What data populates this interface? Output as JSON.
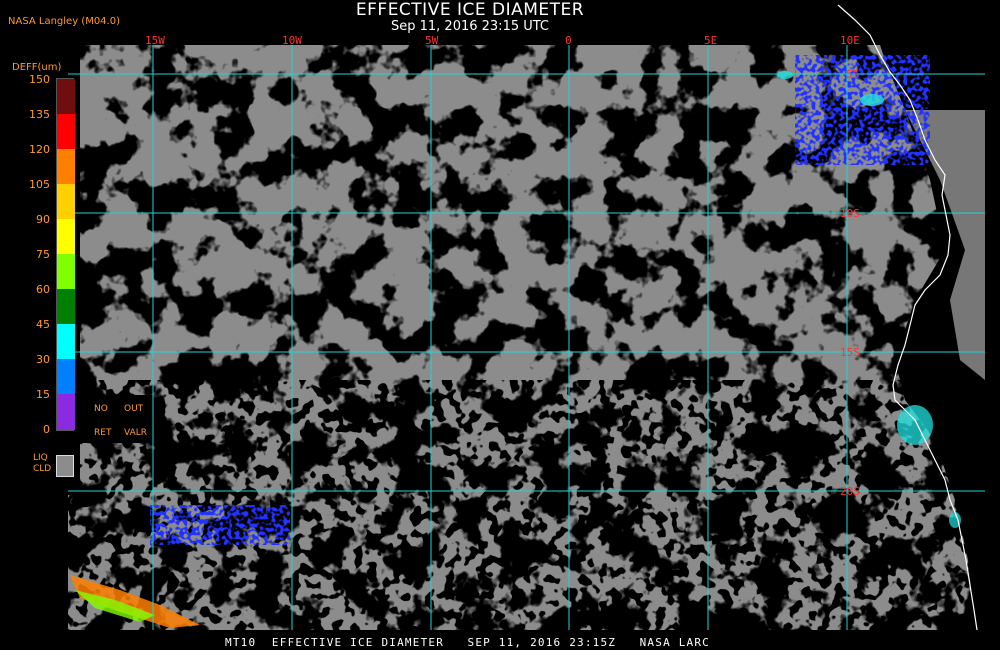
{
  "header": {
    "title": "EFFECTIVE ICE DIAMETER",
    "subtitle": "Sep 11, 2016 23:15 UTC",
    "producer": "NASA Langley (M04.0)"
  },
  "map": {
    "longitude_labels": [
      "15W",
      "10W",
      "5W",
      "0",
      "5E",
      "10E"
    ],
    "latitude_labels": [
      "5S",
      "10S",
      "15S",
      "20S"
    ],
    "colors": {
      "clear": "#000000",
      "liquid_cloud": "#8c8c8c",
      "graticule": "#22d3d3",
      "coastline": "#ffffff",
      "grid_label": "#ff3333"
    }
  },
  "legend": {
    "title": "DEFF(um)",
    "ticks": [
      "150",
      "135",
      "120",
      "105",
      "90",
      "75",
      "60",
      "45",
      "30",
      "15",
      "0"
    ],
    "colors": [
      "#6e0e0e",
      "#ff0000",
      "#ff7f00",
      "#ffd000",
      "#ffff00",
      "#80ff00",
      "#008000",
      "#00ffff",
      "#0080ff",
      "#0000ff",
      "#8a2be2"
    ],
    "no_retrieval_label_1": "NO",
    "no_retrieval_label_2": "RET",
    "out_of_range_label_1": "OUT",
    "out_of_range_label_2": "VALR",
    "liquid_cloud_label_1": "LIQ",
    "liquid_cloud_label_2": "CLD",
    "liquid_cloud_color": "#8c8c8c"
  },
  "footer": {
    "text": "MT10  EFFECTIVE ICE DIAMETER   SEP 11, 2016 23:15Z   NASA LARC"
  }
}
